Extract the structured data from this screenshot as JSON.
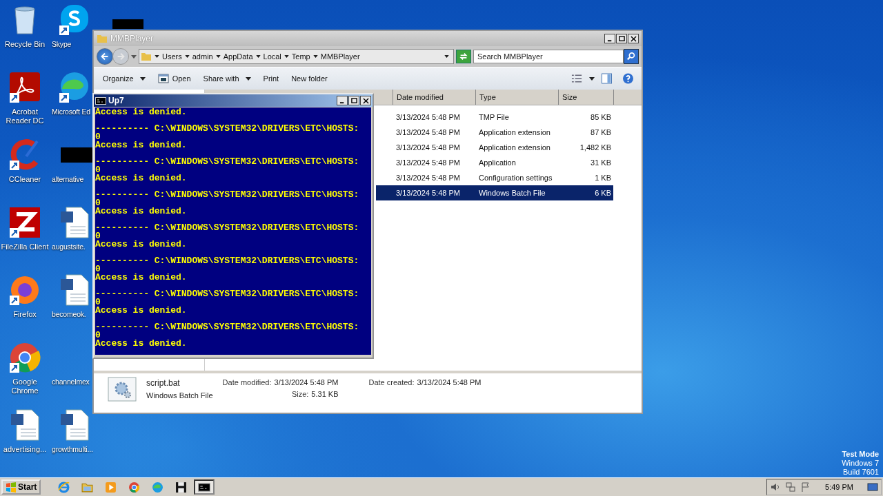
{
  "desktop_icons": [
    {
      "label": "Recycle Bin",
      "kind": "recycle"
    },
    {
      "label": "Skype",
      "kind": "skype"
    },
    {
      "label": "Acrobat Reader DC",
      "kind": "acrobat"
    },
    {
      "label": "Microsoft Ed",
      "kind": "edge"
    },
    {
      "label": "CCleaner",
      "kind": "ccleaner"
    },
    {
      "label": "alternative",
      "kind": "redacted"
    },
    {
      "label": "FileZilla Client",
      "kind": "filezilla"
    },
    {
      "label": "augustsite.",
      "kind": "word"
    },
    {
      "label": "Firefox",
      "kind": "firefox"
    },
    {
      "label": "becomeok.",
      "kind": "word"
    },
    {
      "label": "Google Chrome",
      "kind": "chrome"
    },
    {
      "label": "channelmex",
      "kind": "blank"
    },
    {
      "label": "advertising...",
      "kind": "word"
    },
    {
      "label": "growthmulti...",
      "kind": "word"
    }
  ],
  "explorer": {
    "title": "MMBPlayer",
    "breadcrumbs": [
      "Users",
      "admin",
      "AppData",
      "Local",
      "Temp",
      "MMBPlayer"
    ],
    "search": {
      "placeholder": "Search MMBPlayer"
    },
    "toolbar": [
      {
        "label": "Organize",
        "kind": "menu"
      },
      {
        "label": "Open",
        "kind": "open"
      },
      {
        "label": "Share with",
        "kind": "menu"
      },
      {
        "label": "Print",
        "kind": "plain"
      },
      {
        "label": "New folder",
        "kind": "plain"
      }
    ],
    "columns": [
      "Date modified",
      "Type",
      "Size"
    ],
    "rows": [
      {
        "date": "3/13/2024 5:48 PM",
        "type": "TMP File",
        "size": "85 KB",
        "selected": false
      },
      {
        "date": "3/13/2024 5:48 PM",
        "type": "Application extension",
        "size": "87 KB",
        "selected": false
      },
      {
        "date": "3/13/2024 5:48 PM",
        "type": "Application extension",
        "size": "1,482 KB",
        "selected": false
      },
      {
        "date": "3/13/2024 5:48 PM",
        "type": "Application",
        "size": "31 KB",
        "selected": false
      },
      {
        "date": "3/13/2024 5:48 PM",
        "type": "Configuration settings",
        "size": "1 KB",
        "selected": false
      },
      {
        "date": "3/13/2024 5:48 PM",
        "type": "Windows Batch File",
        "size": "6 KB",
        "selected": true
      }
    ],
    "details": {
      "name": "script.bat",
      "type": "Windows Batch File",
      "modified_label": "Date modified:",
      "modified": "3/13/2024 5:48 PM",
      "size_label": "Size:",
      "size": "5.31 KB",
      "created_label": "Date created:",
      "created": "3/13/2024 5:48 PM"
    }
  },
  "console": {
    "title": "Up7",
    "first_line": "Access is denied.",
    "entries": [
      {
        "header": "---------- C:\\WINDOWS\\SYSTEM32\\DRIVERS\\ETC\\HOSTS:",
        "value": "0",
        "message": "Access is denied."
      },
      {
        "header": "---------- C:\\WINDOWS\\SYSTEM32\\DRIVERS\\ETC\\HOSTS:",
        "value": "0",
        "message": "Access is denied."
      },
      {
        "header": "---------- C:\\WINDOWS\\SYSTEM32\\DRIVERS\\ETC\\HOSTS:",
        "value": "0",
        "message": "Access is denied."
      },
      {
        "header": "---------- C:\\WINDOWS\\SYSTEM32\\DRIVERS\\ETC\\HOSTS:",
        "value": "0",
        "message": "Access is denied."
      },
      {
        "header": "---------- C:\\WINDOWS\\SYSTEM32\\DRIVERS\\ETC\\HOSTS:",
        "value": "0",
        "message": "Access is denied."
      },
      {
        "header": "---------- C:\\WINDOWS\\SYSTEM32\\DRIVERS\\ETC\\HOSTS:",
        "value": "0",
        "message": "Access is denied."
      },
      {
        "header": "---------- C:\\WINDOWS\\SYSTEM32\\DRIVERS\\ETC\\HOSTS:",
        "value": "0",
        "message": "Access is denied."
      }
    ]
  },
  "test_mode": [
    "Test Mode",
    "Windows 7",
    "Build 7601"
  ],
  "taskbar": {
    "start": "Start",
    "apps": [
      {
        "kind": "ie",
        "active": false
      },
      {
        "kind": "folder",
        "active": false
      },
      {
        "kind": "media",
        "active": false
      },
      {
        "kind": "chrome",
        "active": false
      },
      {
        "kind": "edge",
        "active": false
      },
      {
        "kind": "floppy",
        "active": false
      },
      {
        "kind": "cmd",
        "active": true
      }
    ],
    "clock": "5:49 PM"
  }
}
